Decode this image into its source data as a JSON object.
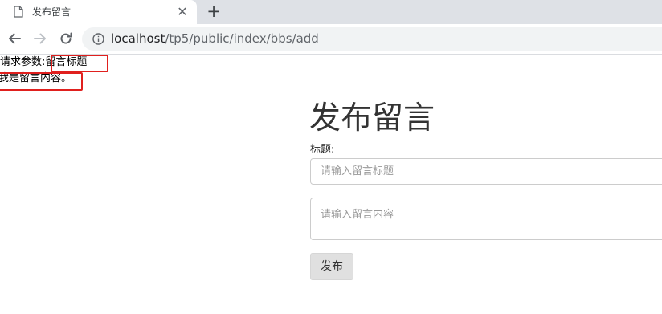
{
  "browser": {
    "tab_title": "发布留言",
    "tab_close_glyph": "✕",
    "new_tab_glyph": "+",
    "url_host": "localhost",
    "url_path": "/tp5/public/index/bbs/add"
  },
  "debug": {
    "params_label": "请求参数:",
    "params_value": "留言标题",
    "content_value": "我是留言内容。"
  },
  "form": {
    "heading": "发布留言",
    "title_label": "标题:",
    "title_placeholder": "请输入留言标题",
    "content_placeholder": "请输入留言内容",
    "submit_label": "发布"
  },
  "colors": {
    "highlight_box": "#e0201e",
    "tabstrip_bg": "#dee1e6",
    "omnibox_bg": "#f1f3f4"
  }
}
